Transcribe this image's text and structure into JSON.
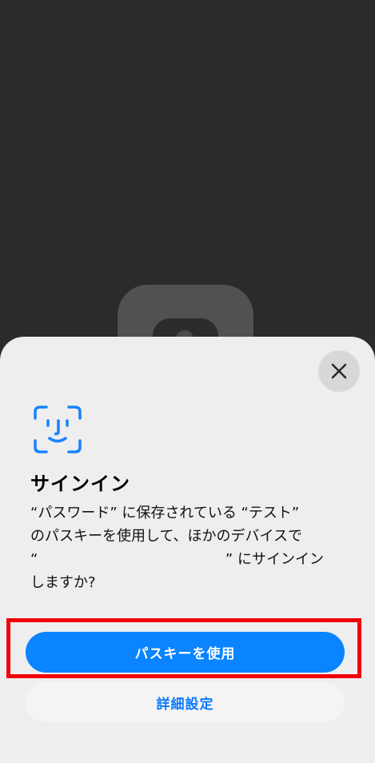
{
  "background_app": {
    "icon": "app-icon"
  },
  "sheet": {
    "close_icon": "close-icon",
    "face_id_icon": "face-id-icon",
    "title": "サインイン",
    "message_lines": [
      "“パスワード” に保存されている “テスト”",
      "のパスキーを使用して、ほかのデバイスで",
      "“                                         ” にサインイン",
      "しますか?"
    ],
    "primary_button": "パスキーを使用",
    "secondary_button": "詳細設定"
  },
  "colors": {
    "accent": "#0a84ff",
    "highlight": "#f00108",
    "sheet_bg": "#efeeef",
    "screen_bg": "#2b2a2c"
  }
}
